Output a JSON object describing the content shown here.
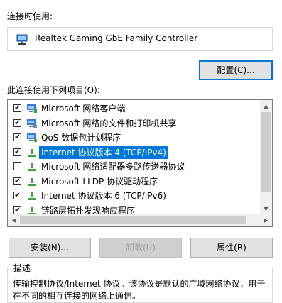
{
  "connect_using_label": "连接时使用:",
  "adapter": {
    "name": "Realtek Gaming GbE Family Controller",
    "icon": "network-adapter-icon"
  },
  "configure_button": "配置(C)...",
  "items_label": "此连接使用下列项目(O):",
  "items": [
    {
      "label": "Microsoft 网络客户端",
      "checked": true,
      "icon": "network-client-icon",
      "selected": false
    },
    {
      "label": "Microsoft 网络的文件和打印机共享",
      "checked": true,
      "icon": "network-share-icon",
      "selected": false
    },
    {
      "label": "QoS 数据包计划程序",
      "checked": true,
      "icon": "network-qos-icon",
      "selected": false
    },
    {
      "label": "Internet 协议版本 4 (TCP/IPv4)",
      "checked": true,
      "icon": "protocol-icon",
      "selected": true
    },
    {
      "label": "Microsoft 网络适配器多路传送器协议",
      "checked": false,
      "icon": "protocol-icon",
      "selected": false
    },
    {
      "label": "Microsoft LLDP 协议驱动程序",
      "checked": true,
      "icon": "protocol-icon",
      "selected": false
    },
    {
      "label": "Internet 协议版本 6 (TCP/IPv6)",
      "checked": true,
      "icon": "protocol-icon",
      "selected": false
    },
    {
      "label": "链路层拓扑发现响应程序",
      "checked": true,
      "icon": "protocol-icon",
      "selected": false
    }
  ],
  "buttons": {
    "install": "安装(N)...",
    "uninstall": "卸载(U)",
    "properties": "属性(R)"
  },
  "description": {
    "legend": "描述",
    "text": "传输控制协议/Internet 协议。该协议是默认的广域网络协议，用于在不同的相互连接的网络上通信。"
  },
  "colors": {
    "selection": "#0078d7",
    "button": "#e1e1e1"
  }
}
